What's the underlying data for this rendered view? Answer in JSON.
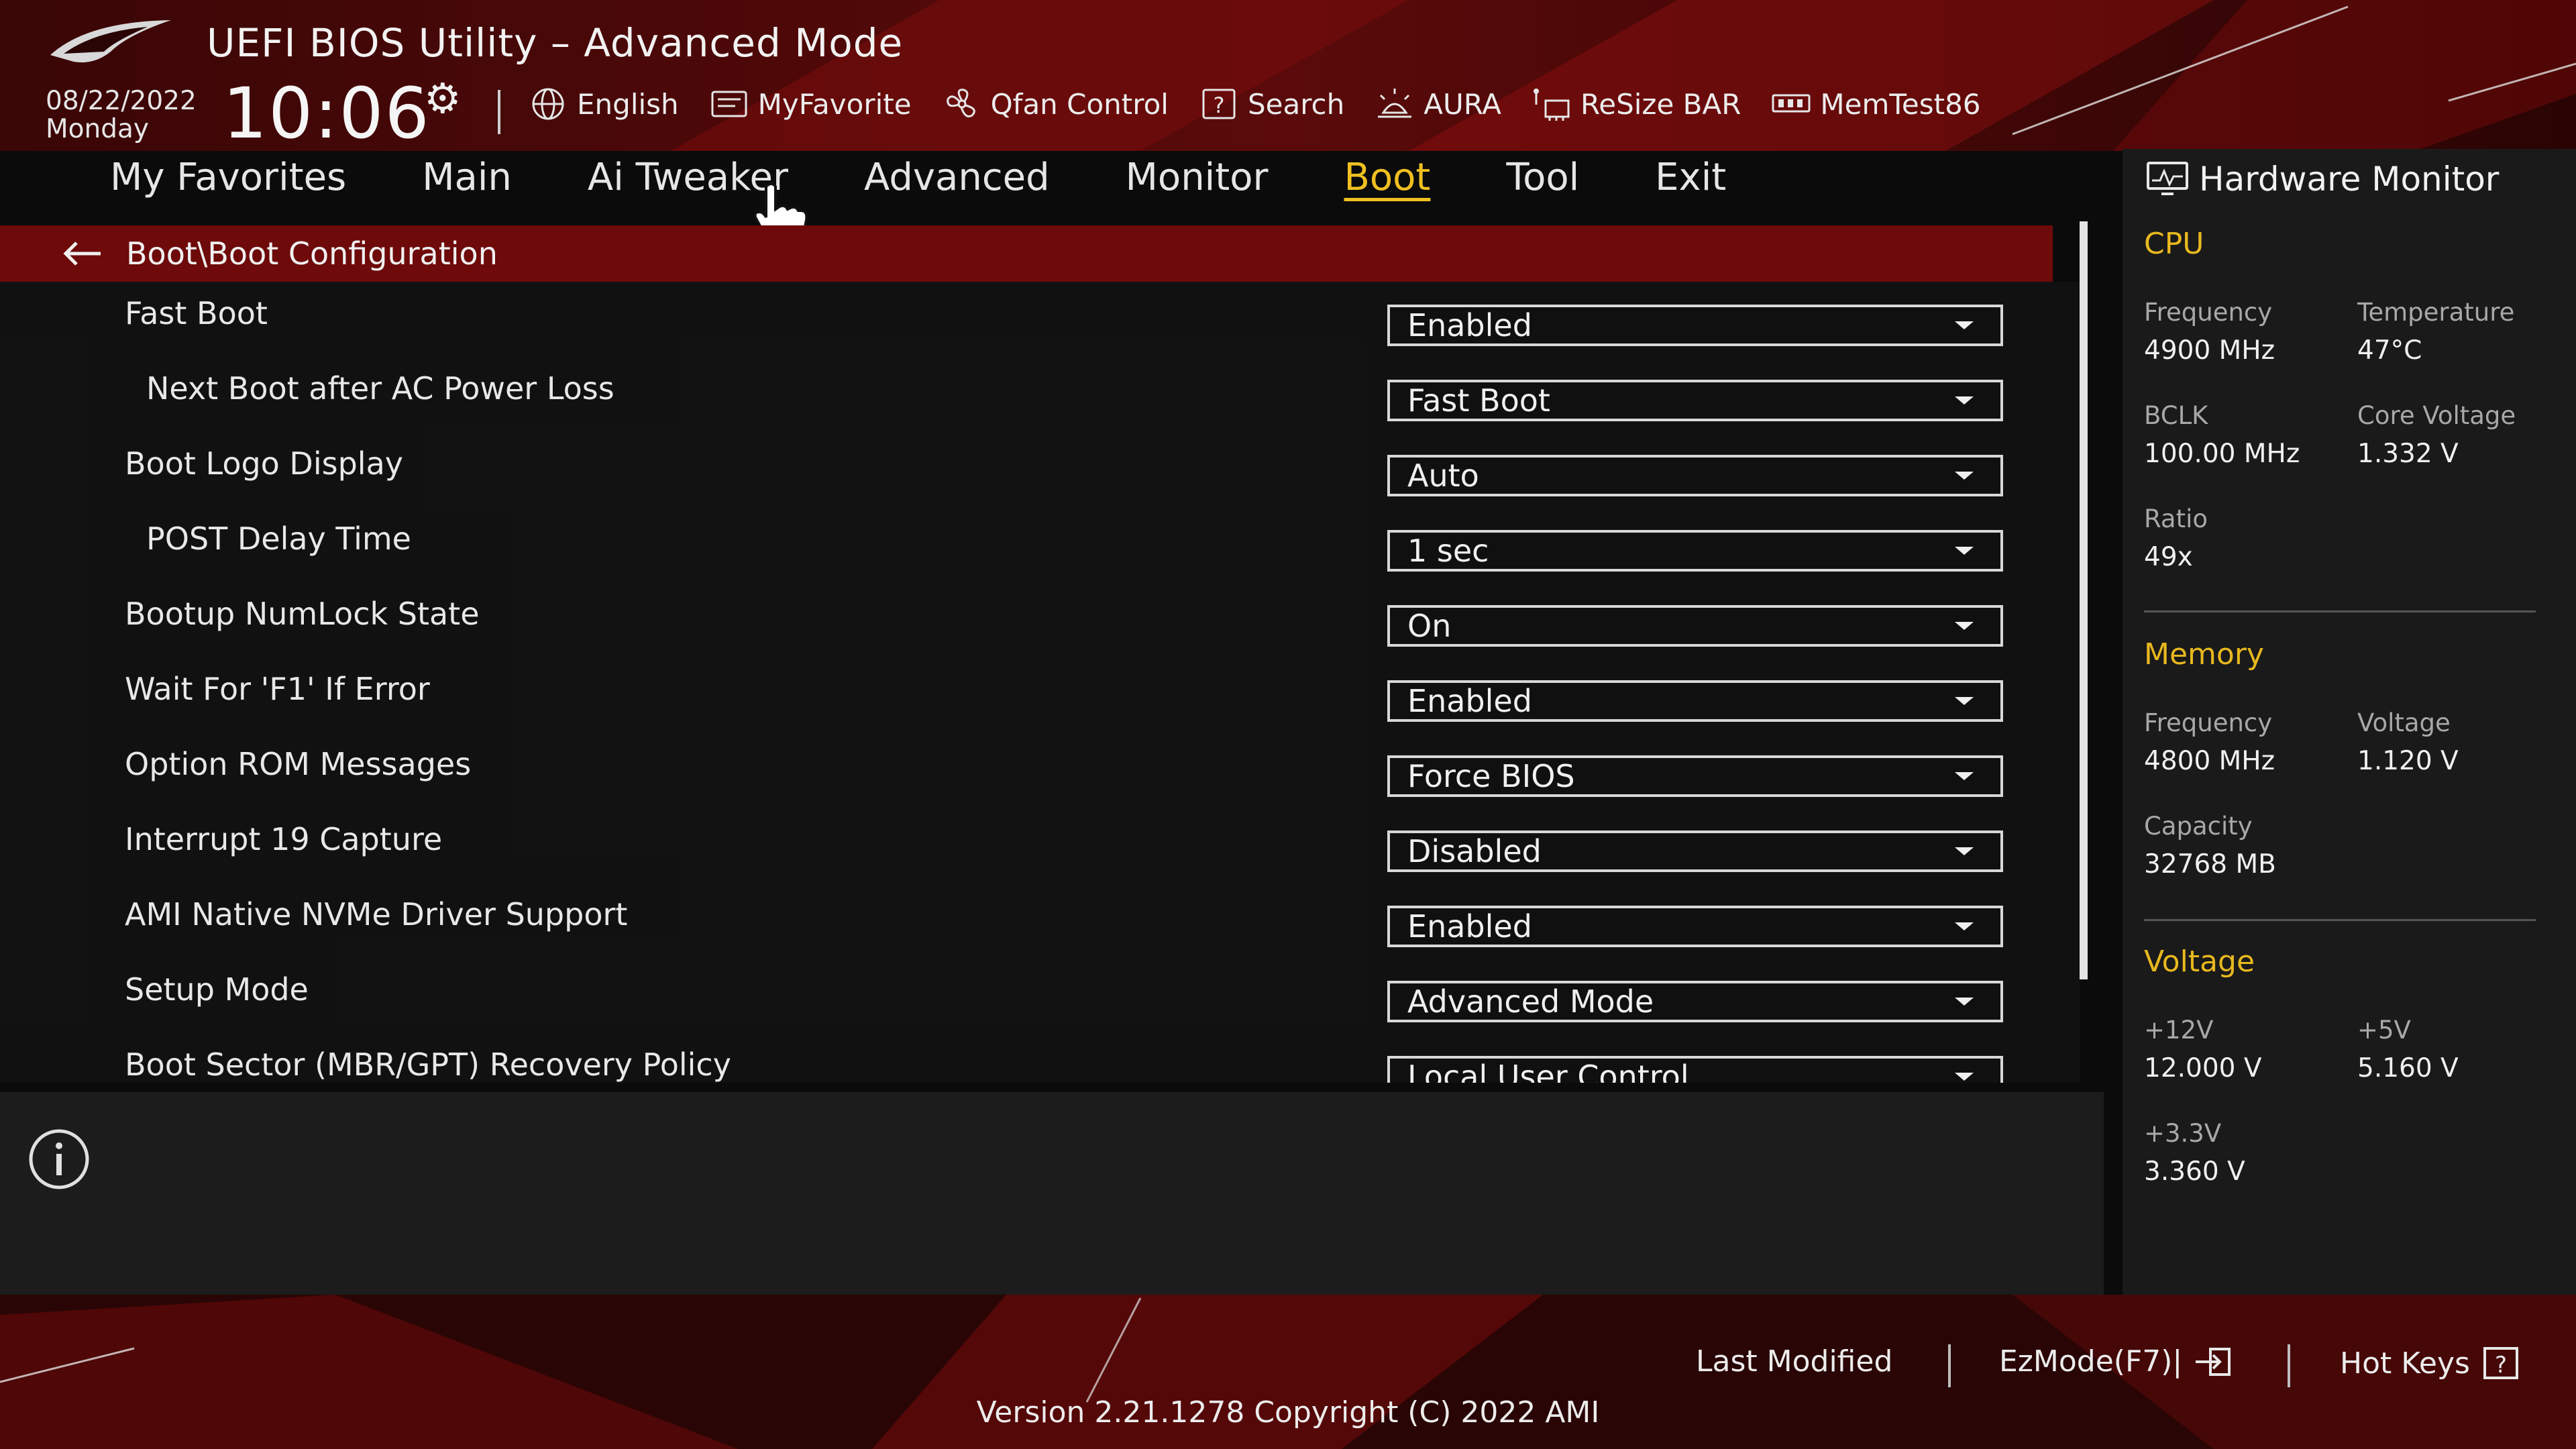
{
  "app": {
    "title": "UEFI BIOS Utility – Advanced Mode",
    "date": "08/22/2022",
    "day": "Monday",
    "time": "10:06"
  },
  "toolbar": [
    {
      "label": "English",
      "icon": "globe-icon"
    },
    {
      "label": "MyFavorite",
      "icon": "favorite-icon"
    },
    {
      "label": "Qfan Control",
      "icon": "fan-icon"
    },
    {
      "label": "Search",
      "icon": "search-icon"
    },
    {
      "label": "AURA",
      "icon": "aura-icon"
    },
    {
      "label": "ReSize BAR",
      "icon": "resize-bar-icon"
    },
    {
      "label": "MemTest86",
      "icon": "memtest-icon"
    }
  ],
  "tabs": [
    {
      "label": "My Favorites"
    },
    {
      "label": "Main"
    },
    {
      "label": "Ai Tweaker"
    },
    {
      "label": "Advanced"
    },
    {
      "label": "Monitor"
    },
    {
      "label": "Boot",
      "active": true
    },
    {
      "label": "Tool"
    },
    {
      "label": "Exit"
    }
  ],
  "breadcrumb": "Boot\\Boot Configuration",
  "settings": [
    {
      "label": "Fast Boot",
      "value": "Enabled",
      "indent": 1
    },
    {
      "label": "Next Boot after AC Power Loss",
      "value": "Fast Boot",
      "indent": 2
    },
    {
      "label": "Boot Logo Display",
      "value": "Auto",
      "indent": 1
    },
    {
      "label": "POST Delay Time",
      "value": "1 sec",
      "indent": 2
    },
    {
      "label": "Bootup NumLock State",
      "value": "On",
      "indent": 1
    },
    {
      "label": "Wait For 'F1' If Error",
      "value": "Enabled",
      "indent": 1
    },
    {
      "label": "Option ROM Messages",
      "value": "Force BIOS",
      "indent": 1
    },
    {
      "label": "Interrupt 19 Capture",
      "value": "Disabled",
      "indent": 1
    },
    {
      "label": "AMI Native NVMe Driver Support",
      "value": "Enabled",
      "indent": 1
    },
    {
      "label": "Setup Mode",
      "value": "Advanced Mode",
      "indent": 1
    },
    {
      "label": "Boot Sector (MBR/GPT) Recovery Policy",
      "value": "Local User Control",
      "indent": 1
    }
  ],
  "hardware_monitor": {
    "title": "Hardware Monitor",
    "cpu": {
      "heading": "CPU",
      "frequency_label": "Frequency",
      "frequency": "4900 MHz",
      "temperature_label": "Temperature",
      "temperature": "47°C",
      "bclk_label": "BCLK",
      "bclk": "100.00 MHz",
      "core_voltage_label": "Core Voltage",
      "core_voltage": "1.332 V",
      "ratio_label": "Ratio",
      "ratio": "49x"
    },
    "memory": {
      "heading": "Memory",
      "frequency_label": "Frequency",
      "frequency": "4800 MHz",
      "voltage_label": "Voltage",
      "voltage": "1.120 V",
      "capacity_label": "Capacity",
      "capacity": "32768 MB"
    },
    "voltage": {
      "heading": "Voltage",
      "v12_label": "+12V",
      "v12": "12.000 V",
      "v5_label": "+5V",
      "v5": "5.160 V",
      "v33_label": "+3.3V",
      "v33": "3.360 V"
    }
  },
  "footer": {
    "last_modified": "Last Modified",
    "ezmode": "EzMode(F7)|",
    "hotkeys": "Hot Keys",
    "version": "Version 2.21.1278 Copyright (C) 2022 AMI"
  },
  "colors": {
    "accent": "#e8b81e",
    "breadcrumb_bg": "#6e0a0a",
    "brand_red": "#a01010"
  }
}
